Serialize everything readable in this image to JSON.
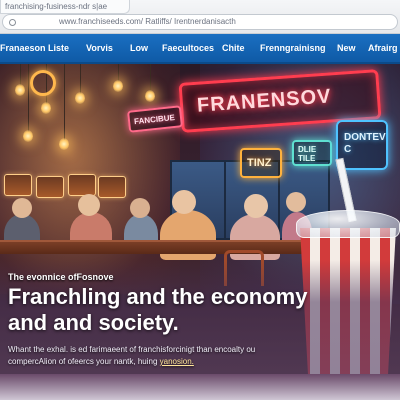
{
  "browser": {
    "tab_title": "franchising-fusiness-ndr s|ae",
    "url": "www.franchiseeds.com/ Ratliffs/ Irentnerdanisacth"
  },
  "nav": {
    "items": [
      "Franaeson",
      "Liste",
      "Vorvis",
      "Low",
      "Faecultoces",
      "Chite",
      "Frenngrainisng",
      "New",
      "Afrairg"
    ]
  },
  "hero": {
    "neon_main": "FRANENSOV",
    "neon_small": "FANCIBUE",
    "neon_blue": [
      "DONTEV",
      "C"
    ],
    "neon_tinz": "TINZ",
    "neon_teal": [
      "DLIE",
      "TILE"
    ],
    "kicker": "The evonnice ofFosnove",
    "headline_line1": "Franchling and the economy",
    "headline_line2": "and and society.",
    "excerpt_line1": "Whant the exhal. is ed farimaeent of franchisforcinigt than encoalty ou",
    "excerpt_line2_prefix": "compercAlion of ofeercs your nantk, huing ",
    "excerpt_link": "yanosion."
  },
  "colors": {
    "nav_bg": "#1266b8",
    "neon_red": "#ff3d4f",
    "neon_blue": "#4fc3ff",
    "cup_red": "#d23b3b"
  }
}
